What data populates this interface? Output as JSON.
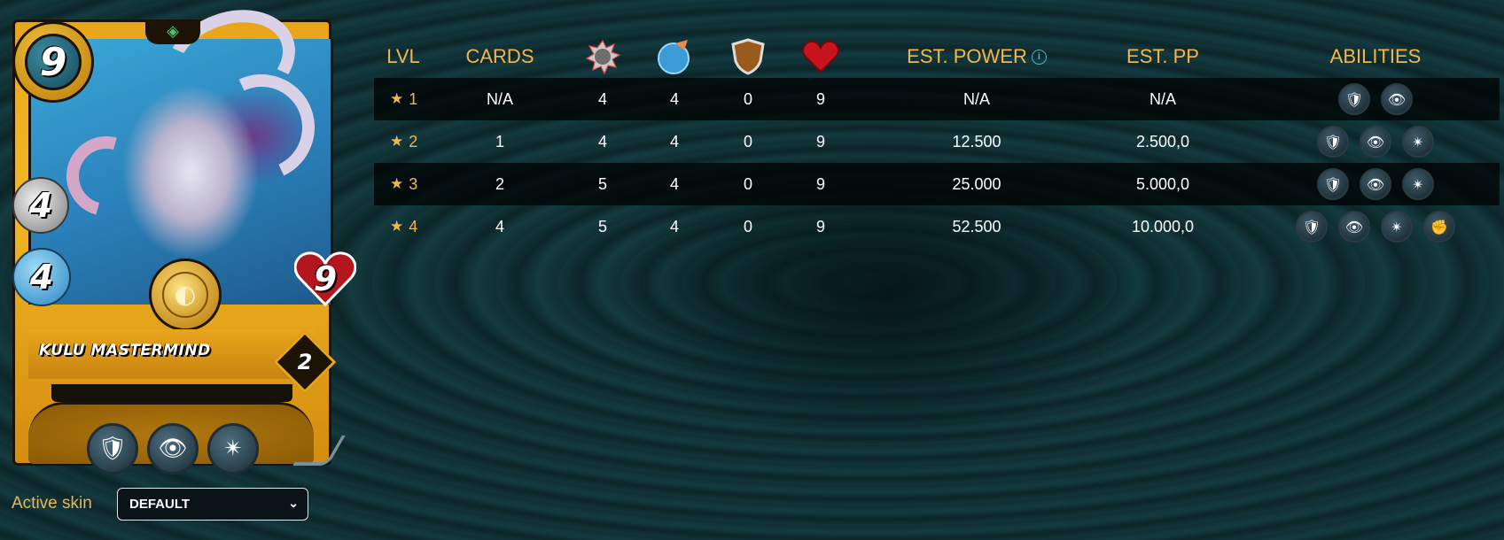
{
  "card": {
    "name": "KULU MASTERMIND",
    "mana": "9",
    "melee": "4",
    "speed": "4",
    "health": "9",
    "level": "2",
    "abilities": [
      "shield-bearer-icon",
      "eye-icon",
      "blast-icon"
    ]
  },
  "skin": {
    "label": "Active skin",
    "selected": "DEFAULT"
  },
  "table": {
    "headers": {
      "lvl": "LVL",
      "cards": "CARDS",
      "melee_icon": "melee-icon",
      "speed_icon": "speed-icon",
      "armor_icon": "armor-icon",
      "health_icon": "health-icon",
      "est_power": "EST. POWER",
      "est_pp": "EST. PP",
      "abilities": "ABILITIES"
    },
    "rows": [
      {
        "lvl": "1",
        "cards": "N/A",
        "melee": "4",
        "speed": "4",
        "armor": "0",
        "health": "9",
        "est_power": "N/A",
        "est_pp": "N/A",
        "abilities": [
          "shield-bearer-icon",
          "eye-icon"
        ]
      },
      {
        "lvl": "2",
        "cards": "1",
        "melee": "4",
        "speed": "4",
        "armor": "0",
        "health": "9",
        "est_power": "12.500",
        "est_pp": "2.500,0",
        "abilities": [
          "shield-bearer-icon",
          "eye-icon",
          "blast-icon"
        ]
      },
      {
        "lvl": "3",
        "cards": "2",
        "melee": "5",
        "speed": "4",
        "armor": "0",
        "health": "9",
        "est_power": "25.000",
        "est_pp": "5.000,0",
        "abilities": [
          "shield-bearer-icon",
          "eye-icon",
          "blast-icon"
        ]
      },
      {
        "lvl": "4",
        "cards": "4",
        "melee": "5",
        "speed": "4",
        "armor": "0",
        "health": "9",
        "est_power": "52.500",
        "est_pp": "10.000,0",
        "abilities": [
          "shield-bearer-icon",
          "eye-icon",
          "blast-icon",
          "fist-icon"
        ]
      }
    ]
  },
  "colors": {
    "accent": "#f2b64e",
    "background": "#0f2c30",
    "row_shade": "#000000"
  }
}
